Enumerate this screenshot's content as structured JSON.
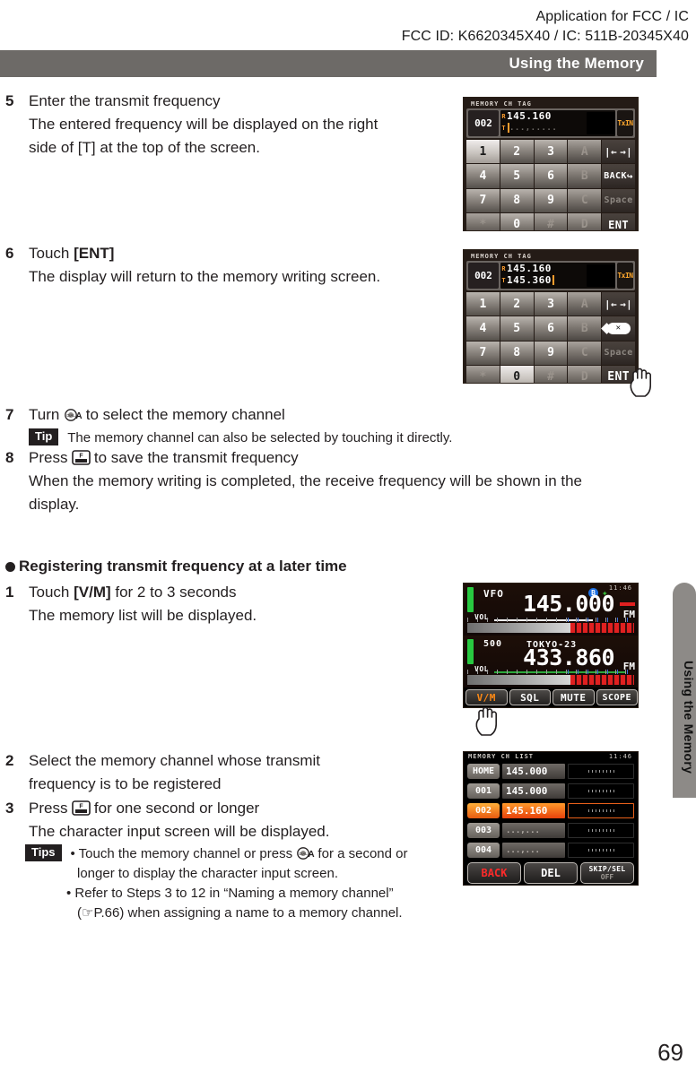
{
  "header": {
    "line1": "Application for FCC /  IC",
    "line2": "FCC ID: K6620345X40 /  IC: 511B-20345X40",
    "running_head": "Using the Memory",
    "side_tab": "Using the Memory",
    "page_number": "69"
  },
  "steps": {
    "s5": {
      "num": "5",
      "title": "Enter the transmit frequency",
      "line1": "The entered frequency will be displayed on the right",
      "line2": "side of [T] at the top of the screen."
    },
    "s6": {
      "num": "6",
      "title_pre": "Touch ",
      "title_b": "[ENT]",
      "line1": "The display will return to the memory writing screen."
    },
    "s7": {
      "num": "7",
      "pre": "Turn ",
      "post": " to select the memory channel",
      "tip_label": "Tip",
      "tip_text": "The memory channel can also be selected by touching it directly."
    },
    "s8": {
      "num": "8",
      "pre": "Press ",
      "post": " to save the transmit frequency",
      "line1": "When the memory writing is completed, the receive frequency will be shown in the",
      "line2": "display."
    },
    "section_title": "Registering transmit frequency at a later time",
    "l1": {
      "num": "1",
      "pre": "Touch ",
      "b": "[V/M]",
      "post": " for 2 to 3 seconds",
      "line1": "The memory list will be displayed."
    },
    "l2": {
      "num": "2",
      "line1": "Select the memory channel whose transmit",
      "line2": "frequency is to be registered"
    },
    "l3": {
      "num": "3",
      "pre": "Press ",
      "post": " for one second or longer",
      "line1": "The character input screen will be displayed.",
      "tips_label": "Tips",
      "tip1_pre": "• Touch the memory channel or press ",
      "tip1_post": " for a second or",
      "tip1_cont": "longer to display the character input screen.",
      "tip2_line1": "• Refer to Steps 3 to 12 in “Naming a memory channel”",
      "tip2_line2": "(☞P.66) when assigning a name to a memory channel."
    }
  },
  "keypad_screen_1": {
    "title": "MEMORY CH TAG",
    "channel": "002",
    "rx_label": "R",
    "rx_freq": "145.160",
    "tx_label": "T",
    "tx_freq": "...,.....",
    "txin": "TxIN",
    "keys": [
      "1",
      "2",
      "3",
      "A",
      "arrows",
      "4",
      "5",
      "6",
      "B",
      "BACK",
      "7",
      "8",
      "9",
      "C",
      "Space",
      "*",
      "0",
      "#",
      "D",
      "ENT"
    ],
    "pressed_key": "1"
  },
  "keypad_screen_2": {
    "title": "MEMORY CH TAG",
    "channel": "002",
    "rx_label": "R",
    "rx_freq": "145.160",
    "tx_label": "T",
    "tx_freq": "145.360",
    "txin": "TxIN",
    "keys": [
      "1",
      "2",
      "3",
      "A",
      "arrows",
      "4",
      "5",
      "6",
      "B",
      "backspace",
      "7",
      "8",
      "9",
      "C",
      "Space",
      "*",
      "0",
      "#",
      "D",
      "ENT"
    ],
    "pressed_key": "0",
    "touch_target": "ENT"
  },
  "vfo_screen": {
    "time": "11:46",
    "main": {
      "label": "VFO",
      "frequency": "145.000",
      "mode": "FM",
      "vol_label": "VOL"
    },
    "sub": {
      "channel": "500",
      "name": "TOKYO-23",
      "frequency": "433.860",
      "mode": "FM",
      "vol_label": "VOL"
    },
    "buttons": [
      "V/M",
      "SQL",
      "MUTE",
      "SCOPE"
    ],
    "touch_target": "V/M"
  },
  "memory_list_screen": {
    "title": "MEMORY CH LIST",
    "time": "11:46",
    "rows": [
      {
        "ch": "HOME",
        "freq": "145.000",
        "selected": false
      },
      {
        "ch": "001",
        "freq": "145.000",
        "selected": false
      },
      {
        "ch": "002",
        "freq": "145.160",
        "selected": true
      },
      {
        "ch": "003",
        "freq": "...,...",
        "selected": false
      },
      {
        "ch": "004",
        "freq": "...,...",
        "selected": false
      }
    ],
    "buttons": {
      "back": "BACK",
      "del": "DEL",
      "skip_sel": "SKIP/SEL",
      "skip_sel_state": "OFF"
    }
  },
  "colors": {
    "headbar": "#6d6a67",
    "accent_orange": "#ff9d2e",
    "selected_row": "#e8601a",
    "green": "#28c940",
    "red": "#e02020"
  }
}
